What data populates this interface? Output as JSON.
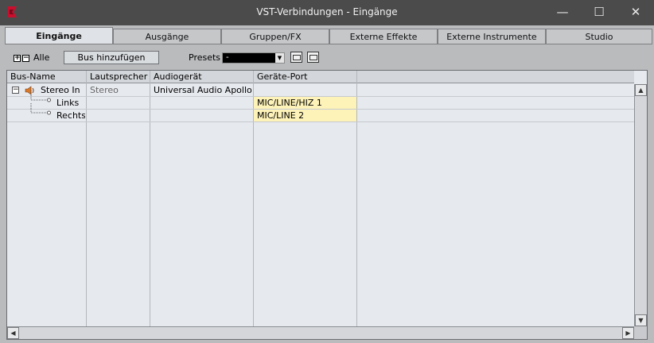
{
  "window": {
    "title": "VST-Verbindungen - Eingänge",
    "min_glyph": "—",
    "max_glyph": "☐",
    "close_glyph": "✕"
  },
  "tabs": [
    {
      "label": "Eingänge",
      "active": true
    },
    {
      "label": "Ausgänge"
    },
    {
      "label": "Gruppen/FX"
    },
    {
      "label": "Externe Effekte"
    },
    {
      "label": "Externe Instrumente"
    },
    {
      "label": "Studio"
    }
  ],
  "toolbar": {
    "expand_glyph": "+",
    "collapse_glyph": "−",
    "all_label": "Alle",
    "add_bus_label": "Bus hinzufügen",
    "presets_label": "Presets",
    "preset_value": "-",
    "dropdown_glyph": "▼"
  },
  "table": {
    "headers": [
      "Bus-Name",
      "Lautsprecher",
      "Audiogerät",
      "Geräte-Port"
    ],
    "rows": [
      {
        "name": "Stereo In",
        "speaker": "Stereo",
        "device": "Universal Audio Apollo Twin",
        "port": ""
      },
      {
        "name": "Links",
        "speaker": "",
        "device": "",
        "port": "MIC/LINE/HIZ 1"
      },
      {
        "name": "Rechts",
        "speaker": "",
        "device": "",
        "port": "MIC/LINE 2"
      }
    ],
    "tree_collapse_glyph": "−"
  },
  "scroll": {
    "up": "▲",
    "down": "▼",
    "left": "◀",
    "right": "▶"
  },
  "colors": {
    "titlebar": "#4b4b4b",
    "port_highlight": "#fdf2b8",
    "logo": "#c8102e"
  },
  "icons": {
    "app": "cubase-logo-icon",
    "speaker": "speaker-icon",
    "tree": "tree-connector-icon"
  }
}
